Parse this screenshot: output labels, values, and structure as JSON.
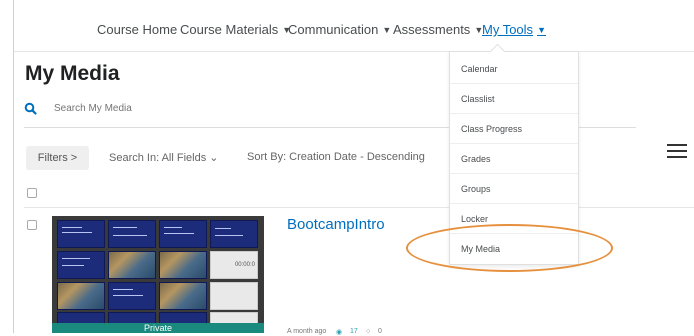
{
  "nav": {
    "items": [
      {
        "label": "Course Home",
        "has_menu": false
      },
      {
        "label": "Course Materials",
        "has_menu": true
      },
      {
        "label": "Communication",
        "has_menu": true
      },
      {
        "label": "Assessments",
        "has_menu": true
      },
      {
        "label": "My Tools",
        "has_menu": true,
        "active": true
      }
    ],
    "chevron": "⌄"
  },
  "page": {
    "title": "My Media"
  },
  "search": {
    "placeholder": "Search My Media"
  },
  "toolbar": {
    "filters_label": "Filters >",
    "search_in": "Search In: All Fields ⌄",
    "sort_by": "Sort By: Creation Date - Descending"
  },
  "media": {
    "title": "BootcampIntro",
    "privacy": "Private",
    "date": "A month ago",
    "views": "17",
    "comments": "0",
    "slide_timestamp": "00:00:0"
  },
  "my_tools_menu": {
    "items": [
      "Calendar",
      "Classlist",
      "Class Progress",
      "Grades",
      "Groups",
      "Locker",
      "My Media"
    ],
    "highlighted": "My Media"
  },
  "colors": {
    "link": "#006fbf",
    "highlight_ring": "#e6903d",
    "privacy_bar": "#1a8a7e"
  }
}
